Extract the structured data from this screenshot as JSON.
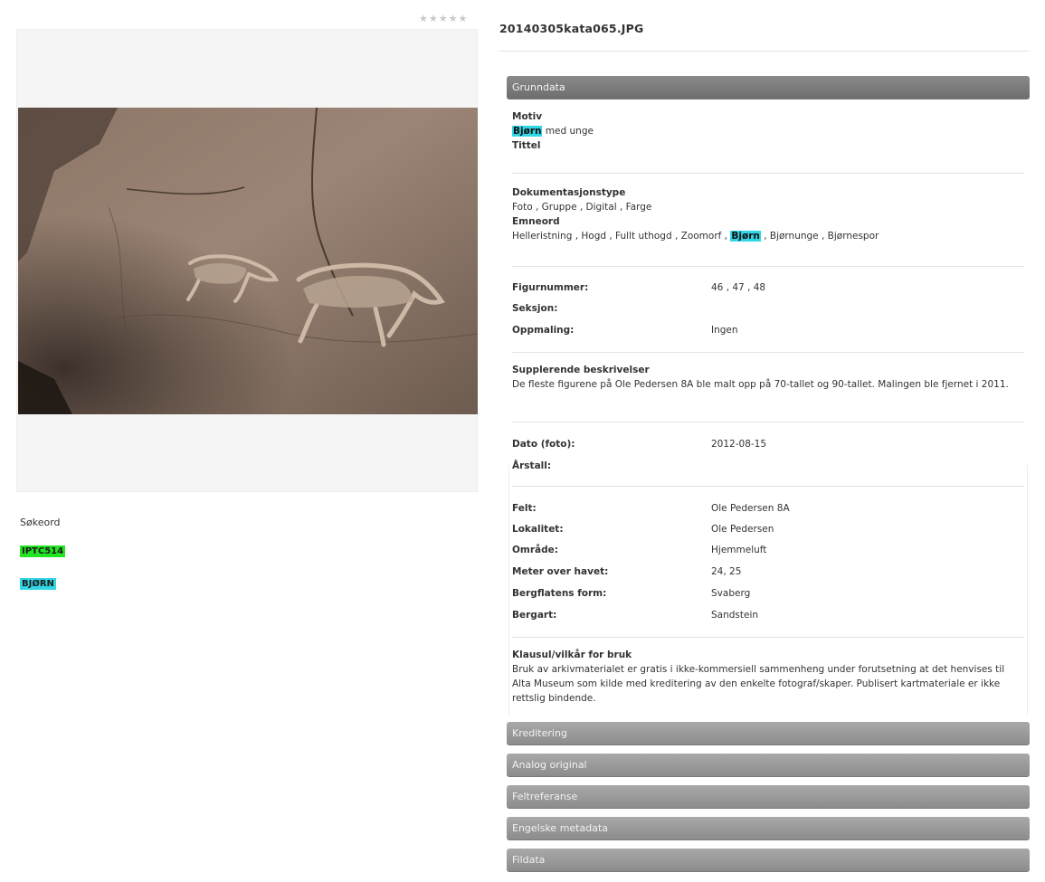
{
  "rating": {
    "stars": "★★★★★"
  },
  "file": {
    "name": "20140305kata065.JPG"
  },
  "keywords": {
    "title": "Søkeord",
    "tags": [
      {
        "label": "IPTC514",
        "color": "#22e622"
      },
      {
        "label": "BJØRN",
        "color": "#32d6e6"
      }
    ]
  },
  "sections": {
    "grunndata": "Grunndata",
    "kreditering": "Kreditering",
    "analog": "Analog original",
    "feltreferanse": "Feltreferanse",
    "engelske": "Engelske metadata",
    "fildata": "Fildata"
  },
  "grunndata": {
    "motiv_label": "Motiv",
    "motiv_highlight": "Bjørn",
    "motiv_rest": " med unge",
    "tittel_label": "Tittel",
    "doktype_label": "Dokumentasjonstype",
    "doktype_value": "Foto , Gruppe , Digital , Farge",
    "emneord_label": "Emneord",
    "emneord_before": "Helleristning , Hogd , Fullt uthogd , Zoomorf , ",
    "emneord_highlight": "Bjørn",
    "emneord_after": " , Bjørnunge , Bjørnespor",
    "figurnummer_label": "Figurnummer:",
    "figurnummer_value": "46 , 47 , 48",
    "seksjon_label": "Seksjon:",
    "oppmaling_label": "Oppmaling:",
    "oppmaling_value": "Ingen",
    "suppl_label": "Supplerende beskrivelser",
    "suppl_value": "De fleste figurene på Ole Pedersen 8A ble malt opp på 70-tallet og 90-tallet. Malingen ble fjernet i 2011.",
    "dato_label": "Dato (foto):",
    "dato_value": "2012-08-15",
    "arstall_label": "Årstall:",
    "felt_label": "Felt:",
    "felt_value": "Ole Pedersen 8A",
    "lokalitet_label": "Lokalitet:",
    "lokalitet_value": "Ole Pedersen",
    "omrade_label": "Område:",
    "omrade_value": "Hjemmeluft",
    "moh_label": "Meter over havet:",
    "moh_value": "24, 25",
    "bergflate_label": "Bergflatens form:",
    "bergflate_value": "Svaberg",
    "bergart_label": "Bergart:",
    "bergart_value": "Sandstein",
    "klausul_label": "Klausul/vilkår for bruk",
    "klausul_value": "Bruk av arkivmaterialet er gratis i ikke-kommersiell sammenheng under forutsetning at det henvises til Alta Museum som kilde med kreditering av den enkelte fotograf/skaper. Publisert kartmateriale er ikke rettslig bindende."
  }
}
